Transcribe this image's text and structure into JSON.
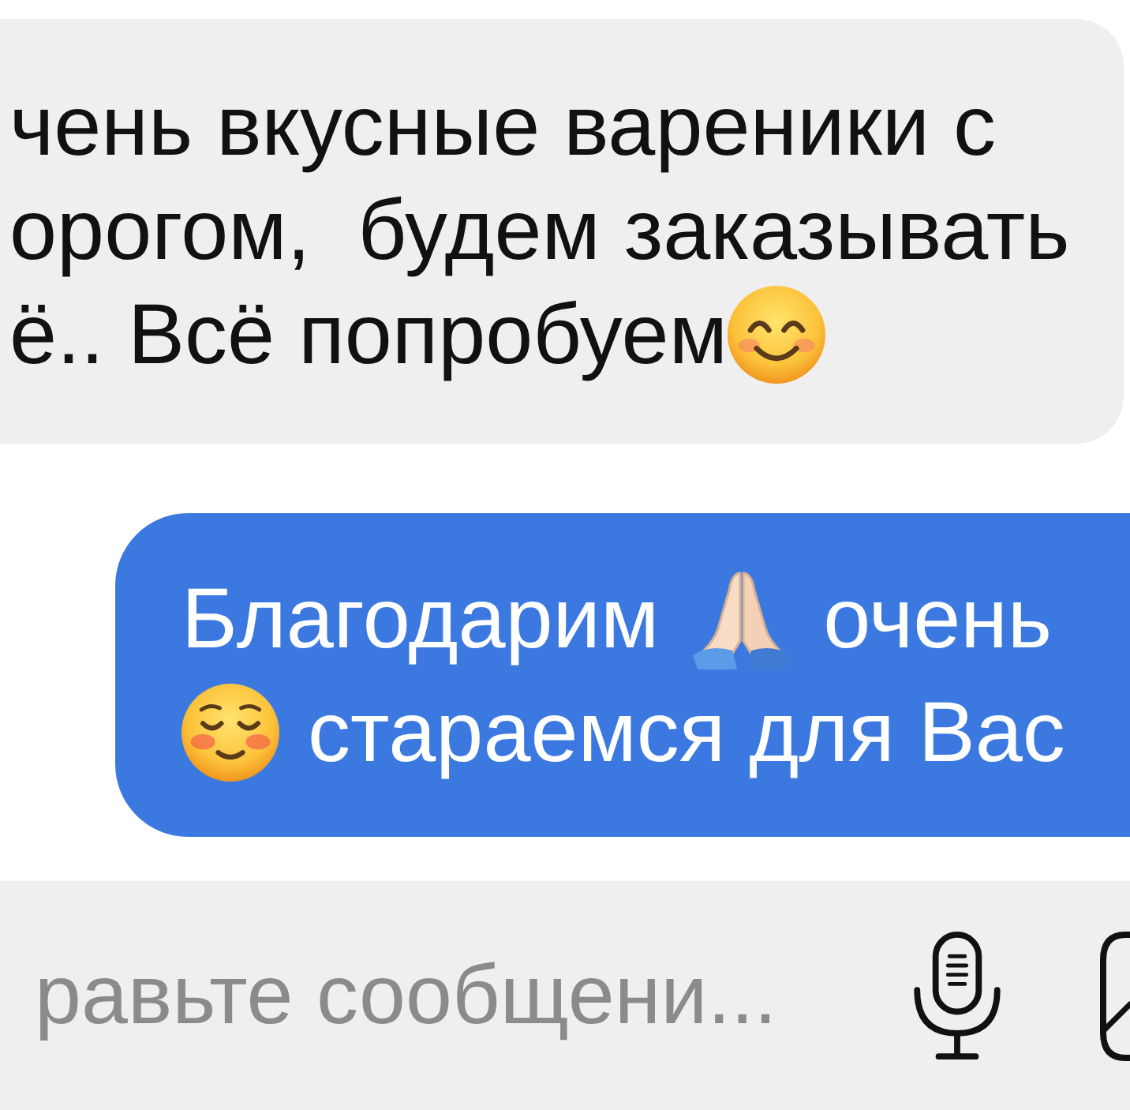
{
  "incoming_message": {
    "lines": [
      [
        {
          "kind": "text",
          "text": "чень вкусные вареники с"
        }
      ],
      [
        {
          "kind": "text",
          "text": "орогом,  будем заказывать"
        }
      ],
      [
        {
          "kind": "text",
          "text": "ё.. Всё попробуем"
        },
        {
          "kind": "smile"
        }
      ]
    ]
  },
  "outgoing_message": {
    "lines": [
      [
        {
          "kind": "text",
          "text": "Благодарим"
        },
        {
          "kind": "pray"
        },
        {
          "kind": "text",
          "text": "очень"
        }
      ],
      [
        {
          "kind": "blush"
        },
        {
          "kind": "text",
          "text": "стараемся для Вас"
        }
      ]
    ]
  },
  "composer": {
    "placeholder": "равьте сообщени..."
  }
}
